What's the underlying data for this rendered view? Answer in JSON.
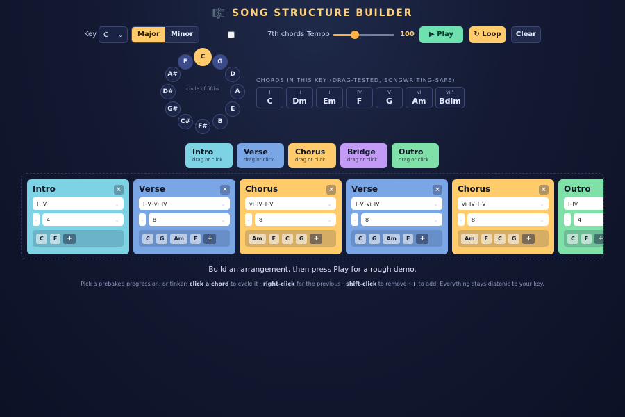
{
  "app": {
    "title": "SONG STRUCTURE BUILDER",
    "title_icon": "sheet-music-icon"
  },
  "controls": {
    "key_label": "Key",
    "key_value": "C",
    "mode_options": [
      "Major",
      "Minor"
    ],
    "mode_selected": "Major",
    "seventh_label": "7th chords",
    "seventh_checked": false,
    "tempo_label": "Tempo",
    "tempo_value": "100",
    "tempo_level": 0.35,
    "play_label": "▶ Play",
    "loop_label": "↻ Loop",
    "clear_label": "Clear"
  },
  "circle": {
    "center_label": "circle of fifths",
    "notes": [
      "C",
      "G",
      "D",
      "A",
      "E",
      "B",
      "F#",
      "C#",
      "G#",
      "D#",
      "A#",
      "F"
    ],
    "selected": "C",
    "neighbors": [
      "G",
      "F"
    ]
  },
  "chords_in_key": {
    "title": "CHORDS IN THIS KEY (DRAG-TESTED, SONGWRITING-SAFE)",
    "items": [
      {
        "roman": "I",
        "name": "C"
      },
      {
        "roman": "ii",
        "name": "Dm"
      },
      {
        "roman": "iii",
        "name": "Em"
      },
      {
        "roman": "IV",
        "name": "F"
      },
      {
        "roman": "V",
        "name": "G"
      },
      {
        "roman": "vi",
        "name": "Am"
      },
      {
        "roman": "vii°",
        "name": "Bdim"
      }
    ]
  },
  "palette": [
    {
      "name": "Intro",
      "sub": "drag or click",
      "color": "#7dd3e3"
    },
    {
      "name": "Verse",
      "sub": "drag or click",
      "color": "#7aa6e6"
    },
    {
      "name": "Chorus",
      "sub": "drag or click",
      "color": "#ffcb6b"
    },
    {
      "name": "Bridge",
      "sub": "drag or click",
      "color": "#c39af5"
    },
    {
      "name": "Outro",
      "sub": "drag or click",
      "color": "#7fe0a8"
    }
  ],
  "timeline": [
    {
      "name": "Intro",
      "progression": "I–IV",
      "bars": "4",
      "chords": [
        "C",
        "F"
      ],
      "color": "#7dd3e3"
    },
    {
      "name": "Verse",
      "progression": "I–V–vi–IV",
      "bars": "8",
      "chords": [
        "C",
        "G",
        "Am",
        "F"
      ],
      "color": "#7aa6e6"
    },
    {
      "name": "Chorus",
      "progression": "vi–IV–I–V",
      "bars": "8",
      "chords": [
        "Am",
        "F",
        "C",
        "G"
      ],
      "color": "#ffcb6b"
    },
    {
      "name": "Verse",
      "progression": "I–V–vi–IV",
      "bars": "8",
      "chords": [
        "C",
        "G",
        "Am",
        "F"
      ],
      "color": "#7aa6e6"
    },
    {
      "name": "Chorus",
      "progression": "vi–IV–I–V",
      "bars": "8",
      "chords": [
        "Am",
        "F",
        "C",
        "G"
      ],
      "color": "#ffcb6b"
    },
    {
      "name": "Outro",
      "progression": "I–IV",
      "bars": "4",
      "chords": [
        "C",
        "F"
      ],
      "color": "#7fe0a8"
    }
  ],
  "add_label": "+",
  "close_label": "×",
  "hint": "Build an arrangement, then press Play for a rough demo.",
  "help": {
    "p1": "Pick a prebaked progression, or tinker: ",
    "b1": "click a chord",
    "p2": " to cycle it · ",
    "b2": "right-click",
    "p3": " for the previous · ",
    "b3": "shift-click",
    "p4": " to remove · ",
    "b4": "+",
    "p5": " to add. Everything stays diatonic to your key."
  }
}
